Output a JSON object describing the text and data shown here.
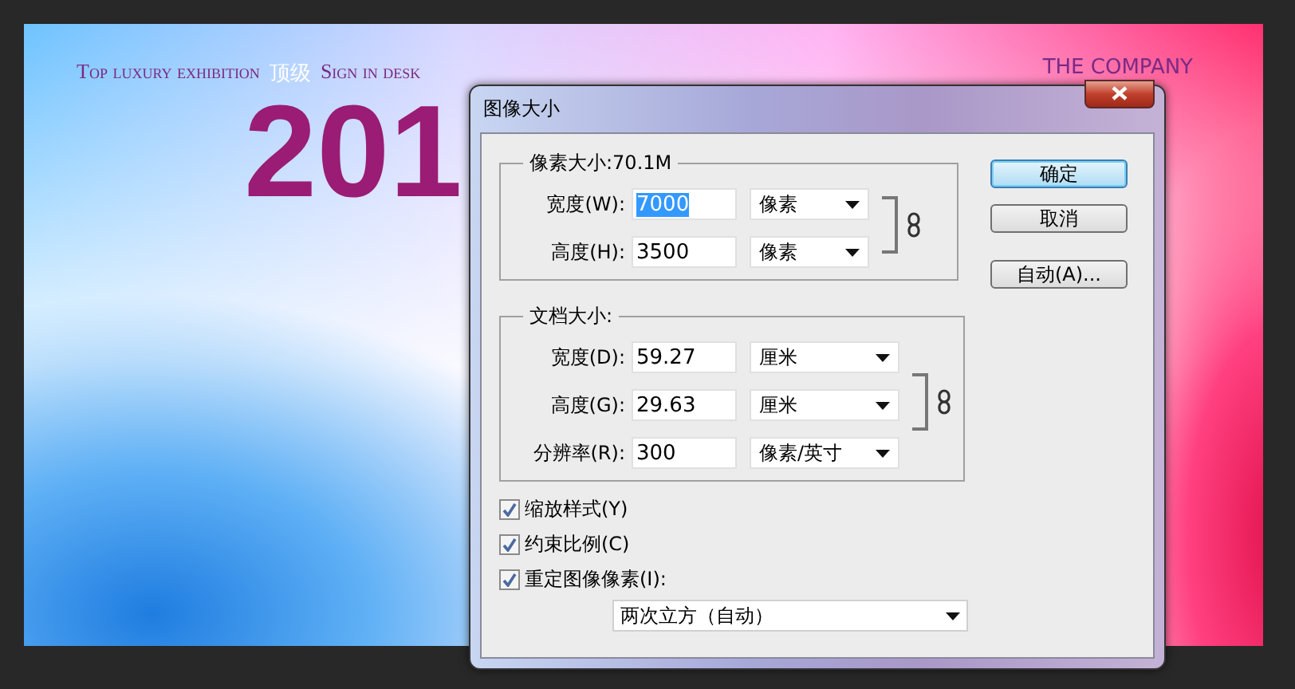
{
  "poster": {
    "headline": [
      "Top luxury exhibition",
      "顶级",
      "Sign in desk"
    ],
    "company": "THE COMPANY",
    "year": "201"
  },
  "dialog": {
    "title": "图像大小",
    "pixel_dimensions": {
      "legend": "像素大小:70.1M",
      "fields": [
        {
          "label": "宽度(W):",
          "value": "7000",
          "unit": "像素",
          "selected": true
        },
        {
          "label": "高度(H):",
          "value": "3500",
          "unit": "像素",
          "selected": false
        }
      ]
    },
    "document_size": {
      "legend": "文档大小:",
      "fields": [
        {
          "label": "宽度(D):",
          "value": "59.27",
          "unit": "厘米",
          "selected": false
        },
        {
          "label": "高度(G):",
          "value": "29.63",
          "unit": "厘米",
          "selected": false
        },
        {
          "label": "分辨率(R):",
          "value": "300",
          "unit": "像素/英寸",
          "selected": false
        }
      ]
    },
    "buttons": [
      {
        "label": "确定",
        "default": true
      },
      {
        "label": "取消",
        "default": false
      },
      {
        "label": "自动(A)...",
        "default": false
      }
    ],
    "checkboxes": [
      {
        "label": "缩放样式(Y)",
        "checked": true
      },
      {
        "label": "约束比例(C)",
        "checked": true
      },
      {
        "label": "重定图像像素(I):",
        "checked": true
      }
    ],
    "resample_method": "两次立方（自动）"
  }
}
